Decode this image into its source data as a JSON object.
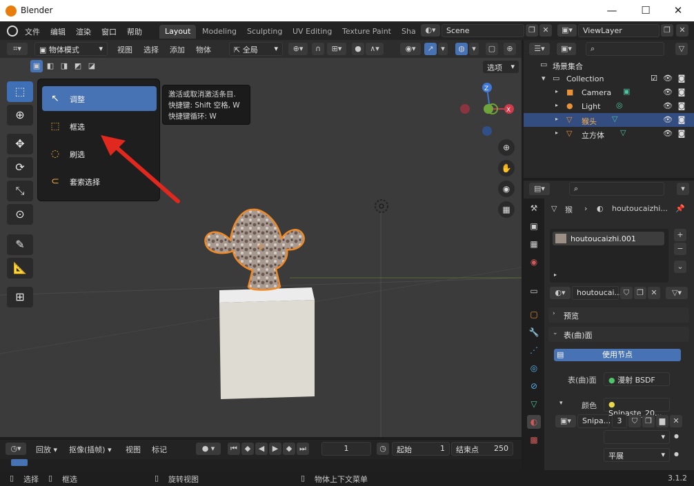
{
  "window": {
    "title": "Blender"
  },
  "menu": {
    "items": [
      "文件",
      "编辑",
      "渲染",
      "窗口",
      "帮助"
    ]
  },
  "workspaces": {
    "tabs": [
      "Layout",
      "Modeling",
      "Sculpting",
      "UV Editing",
      "Texture Paint",
      "Sha"
    ]
  },
  "scene": {
    "name": "Scene",
    "view_layer": "ViewLayer"
  },
  "viewport_header": {
    "mode": "物体模式",
    "menus": [
      "视图",
      "选择",
      "添加",
      "物体"
    ],
    "transform_orientation": "全局",
    "options_label": "选项"
  },
  "tool_popup": {
    "items": [
      {
        "label": "调整",
        "icon": "cursor-tweak-icon",
        "glyph": "↖"
      },
      {
        "label": "框选",
        "icon": "box-select-icon",
        "glyph": "⬚"
      },
      {
        "label": "刷选",
        "icon": "circle-select-icon",
        "glyph": "◌"
      },
      {
        "label": "套索选择",
        "icon": "lasso-select-icon",
        "glyph": "⊂"
      }
    ]
  },
  "tooltip": {
    "line1": "激活或取消激活条目.",
    "line2": "快捷键: Shift 空格, W",
    "line3": "快捷键循环: W"
  },
  "gizmo": {
    "z": "Z",
    "x": "X",
    "y": "Y"
  },
  "timeline": {
    "playback": "回放",
    "keying": "抠像(插帧)",
    "view": "视图",
    "marker": "标记",
    "current_frame": "1",
    "start_label": "起始",
    "start": "1",
    "end_label": "结束点",
    "end": "250"
  },
  "status": {
    "select": "选择",
    "box_select": "框选",
    "rotate_view": "旋转视图",
    "context_menu": "物体上下文菜单",
    "version": "3.1.2"
  },
  "outliner": {
    "root": "场景集合",
    "collection": "Collection",
    "objects": [
      {
        "name": "Camera",
        "icon": "camera-icon",
        "selected": false
      },
      {
        "name": "Light",
        "icon": "light-icon",
        "selected": false
      },
      {
        "name": "猴头",
        "icon": "mesh-icon",
        "selected": true
      },
      {
        "name": "立方体",
        "icon": "mesh-icon",
        "selected": false
      }
    ]
  },
  "properties": {
    "breadcrumb_object": "猴",
    "breadcrumb_material": "houtoucaizhi...",
    "material_slot": "houtoucaizhi.001",
    "material_name": "houtoucai...",
    "preview_label": "预览",
    "surface_label": "表(曲)面",
    "use_nodes_label": "使用节点",
    "surface_field_label": "表(曲)面",
    "surface_value": "漫射 BSDF",
    "color_label": "颜色",
    "color_value": "Snipaste_20...",
    "image_name": "Snipa...",
    "image_users": "3",
    "extra_label": "平展"
  },
  "colors": {
    "accent": "#4772b3",
    "selection_outline": "#f08a28",
    "axis_x": "#d03a4a",
    "axis_y": "#6ea43a",
    "axis_z": "#3f78d6"
  }
}
